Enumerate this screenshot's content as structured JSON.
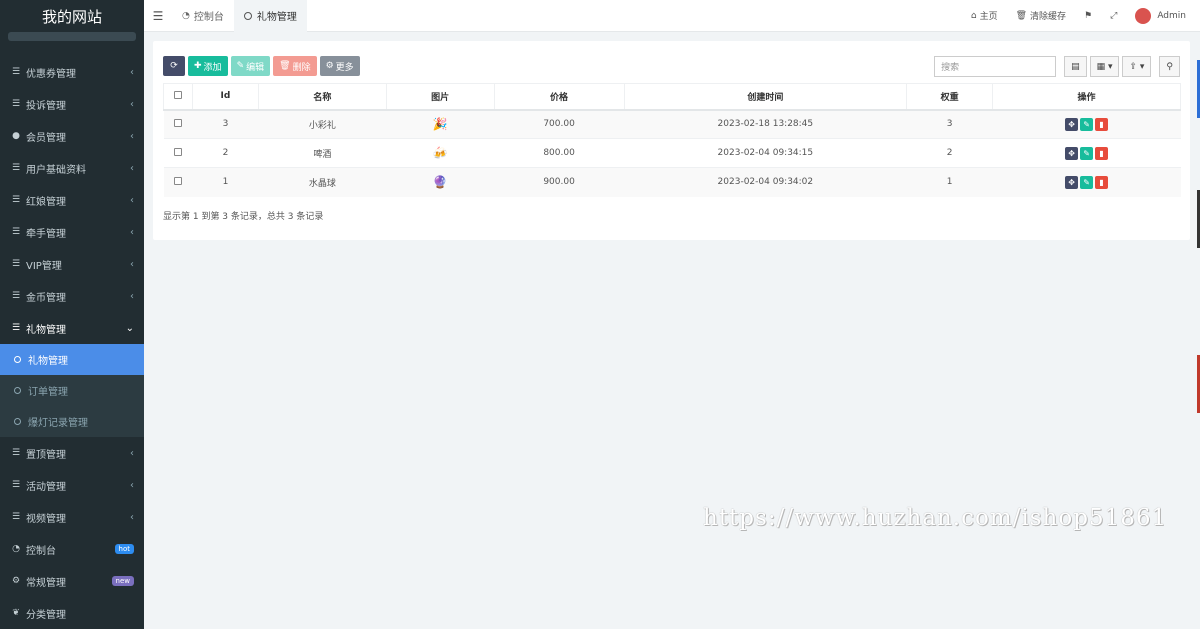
{
  "sidebar": {
    "logo": "我的网站",
    "items_top": [
      {
        "label": "优惠券管理",
        "icon": "list-icon"
      },
      {
        "label": "投诉管理",
        "icon": "list-icon"
      },
      {
        "label": "会员管理",
        "icon": "user-icon"
      },
      {
        "label": "用户基础资料",
        "icon": "list-icon"
      },
      {
        "label": "红娘管理",
        "icon": "list-icon"
      },
      {
        "label": "牵手管理",
        "icon": "list-icon"
      },
      {
        "label": "VIP管理",
        "icon": "list-icon"
      },
      {
        "label": "金币管理",
        "icon": "list-icon"
      },
      {
        "label": "礼物管理",
        "icon": "list-icon"
      }
    ],
    "submenu": [
      {
        "label": "礼物管理",
        "active": true
      },
      {
        "label": "订单管理",
        "active": false
      },
      {
        "label": "爆灯记录管理",
        "active": false
      }
    ],
    "items_bottom": [
      {
        "label": "置顶管理",
        "icon": "list-icon"
      },
      {
        "label": "活动管理",
        "icon": "list-icon"
      },
      {
        "label": "视频管理",
        "icon": "list-icon"
      },
      {
        "label": "控制台",
        "icon": "dashboard-icon",
        "badge": "hot",
        "badge_color": "#2d8cf0"
      },
      {
        "label": "常规管理",
        "icon": "cogs-icon",
        "badge": "new",
        "badge_color": "#7a6fbe"
      },
      {
        "label": "分类管理",
        "icon": "leaf-icon"
      }
    ]
  },
  "header": {
    "tabs": [
      {
        "label": "控制台",
        "active": false
      },
      {
        "label": "礼物管理",
        "active": true
      }
    ],
    "home": "主页",
    "clear_cache": "清除缓存",
    "user": "Admin"
  },
  "toolbar": {
    "add": "添加",
    "edit": "编辑",
    "delete": "删除",
    "more": "更多",
    "search_placeholder": "搜索"
  },
  "table": {
    "columns": [
      "Id",
      "名称",
      "图片",
      "价格",
      "创建时间",
      "权重",
      "操作"
    ],
    "rows": [
      {
        "id": "3",
        "name": "小彩礼",
        "icon": "party-popper-icon",
        "price": "700.00",
        "created": "2023-02-18 13:28:45",
        "weight": "3"
      },
      {
        "id": "2",
        "name": "啤酒",
        "icon": "beer-icon",
        "price": "800.00",
        "created": "2023-02-04 09:34:15",
        "weight": "2"
      },
      {
        "id": "1",
        "name": "水晶球",
        "icon": "crystal-ball-icon",
        "price": "900.00",
        "created": "2023-02-04 09:34:02",
        "weight": "1"
      }
    ]
  },
  "summary": "显示第 1 到第 3 条记录，总共 3 条记录",
  "watermark": "https://www.huzhan.com/ishop51861"
}
